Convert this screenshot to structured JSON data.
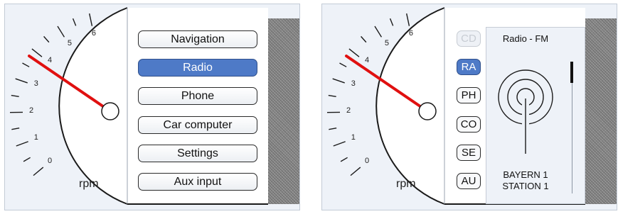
{
  "gauge": {
    "unit": "rpm",
    "ticks": [
      "0",
      "1",
      "2",
      "3",
      "4",
      "5",
      "6"
    ],
    "needle_color": "#e01010"
  },
  "left": {
    "menu": [
      {
        "label": "Navigation",
        "active": false
      },
      {
        "label": "Radio",
        "active": true
      },
      {
        "label": "Phone",
        "active": false
      },
      {
        "label": "Car computer",
        "active": false
      },
      {
        "label": "Settings",
        "active": false
      },
      {
        "label": "Aux input",
        "active": false
      }
    ]
  },
  "right": {
    "sources": [
      {
        "label": "CD",
        "state": "disabled"
      },
      {
        "label": "RA",
        "state": "active"
      },
      {
        "label": "PH",
        "state": "normal"
      },
      {
        "label": "CO",
        "state": "normal"
      },
      {
        "label": "SE",
        "state": "normal"
      },
      {
        "label": "AU",
        "state": "normal"
      }
    ],
    "radio": {
      "title": "Radio - FM",
      "station_line1": "BAYERN 1",
      "station_line2": "STATION 1"
    }
  },
  "colors": {
    "accent": "#4e7ac7",
    "background": "#eef2f8"
  }
}
